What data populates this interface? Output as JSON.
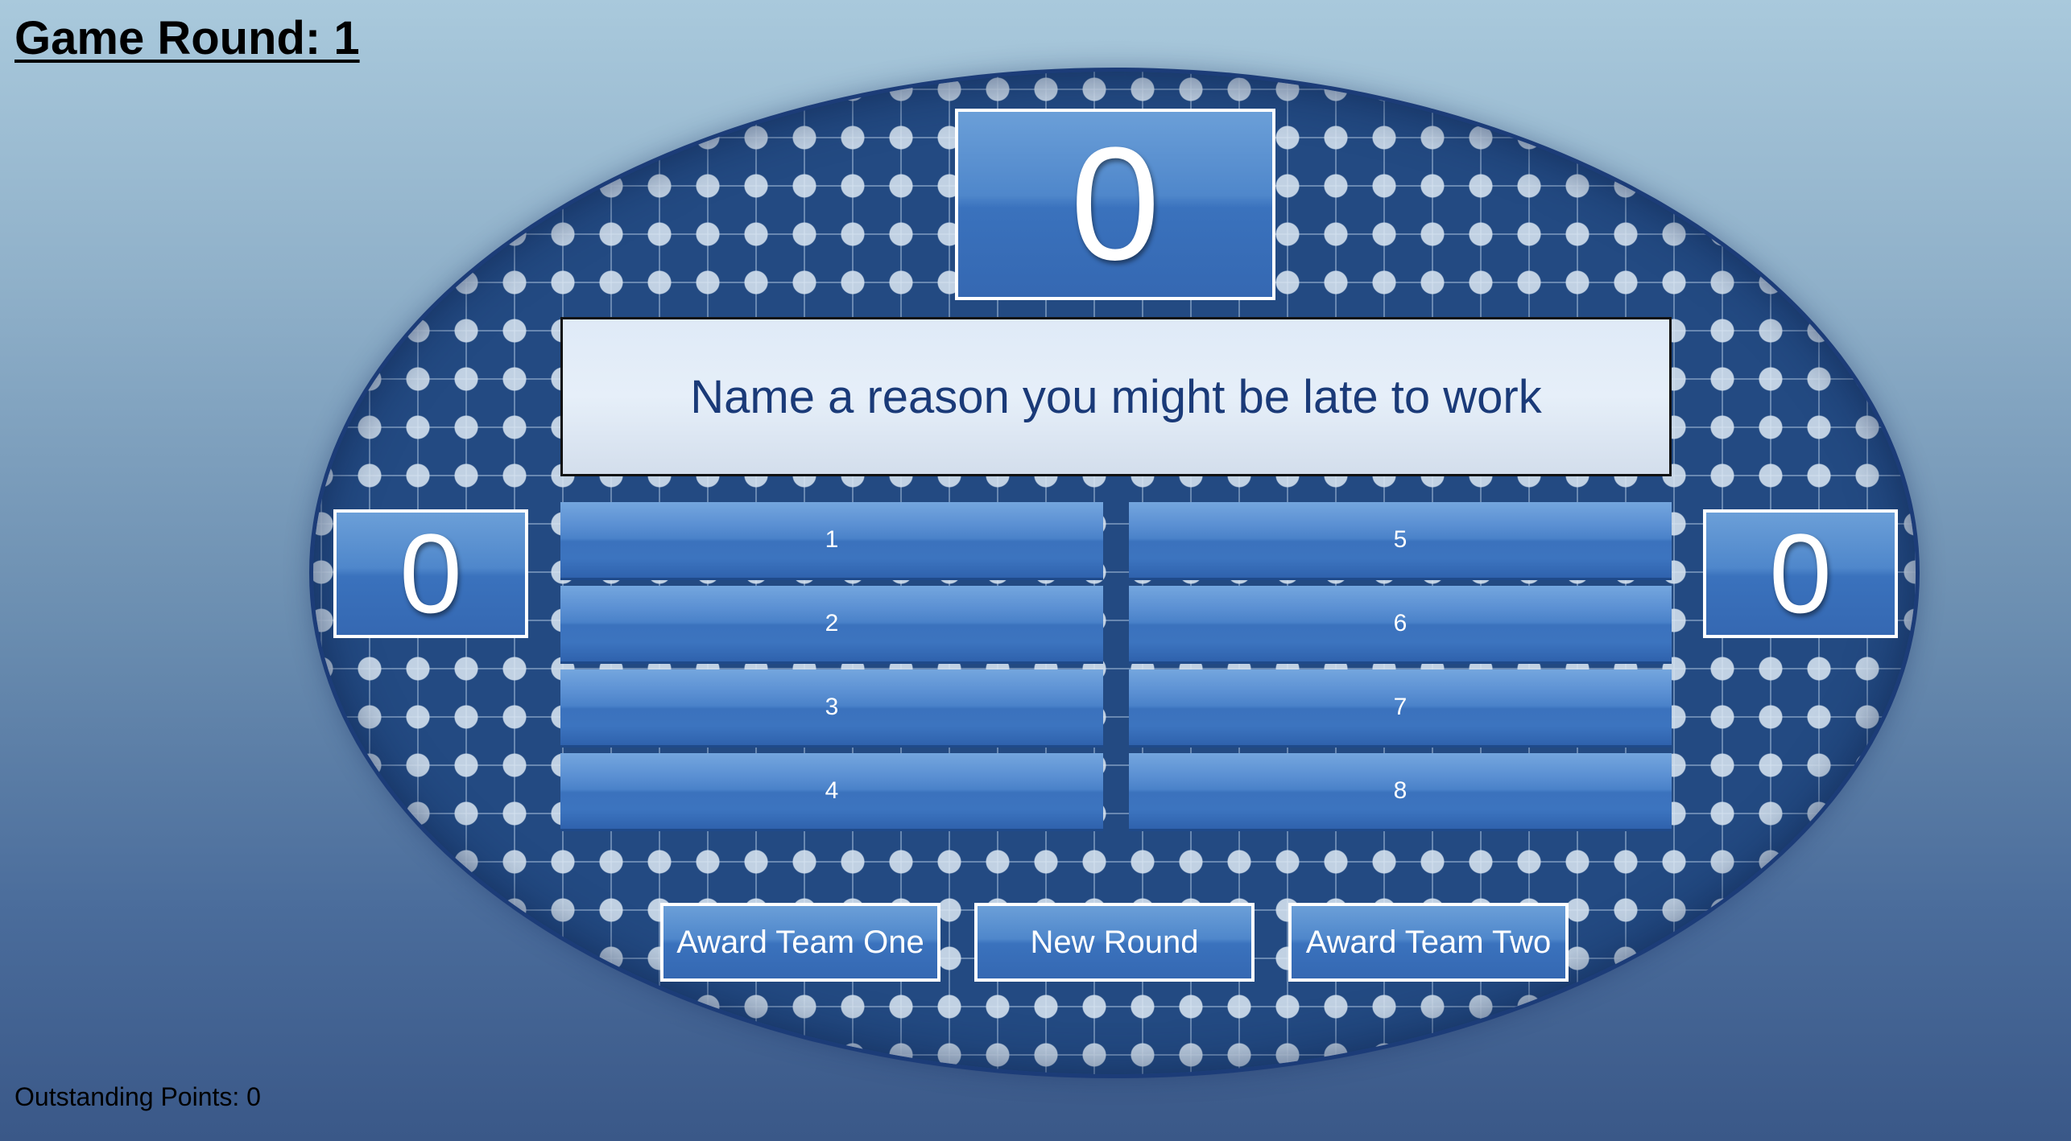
{
  "game": {
    "round_label": "Game Round: 1",
    "outstanding_label": "Outstanding Points: 0"
  },
  "scores": {
    "round_score": "0",
    "team_one": "0",
    "team_two": "0"
  },
  "question": "Name a reason you might be late to work",
  "answers": [
    {
      "slot": "1"
    },
    {
      "slot": "2"
    },
    {
      "slot": "3"
    },
    {
      "slot": "4"
    },
    {
      "slot": "5"
    },
    {
      "slot": "6"
    },
    {
      "slot": "7"
    },
    {
      "slot": "8"
    }
  ],
  "buttons": {
    "award_team_one": "Award Team One",
    "new_round": "New Round",
    "award_team_two": "Award Team Two"
  },
  "colors": {
    "board": "#234a82",
    "tile": "#4a82c9",
    "question_text": "#1a3a78"
  }
}
